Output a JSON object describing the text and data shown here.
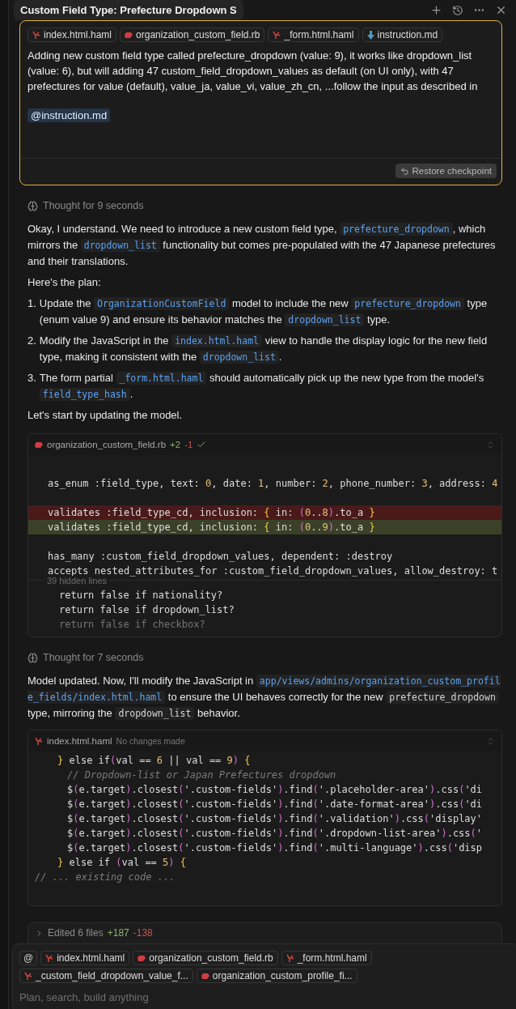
{
  "header": {
    "title": "Custom Field Type: Prefecture Dropdown S"
  },
  "prompt": {
    "attachments": [
      {
        "name": "index.html.haml",
        "kind": "haml"
      },
      {
        "name": "organization_custom_field.rb",
        "kind": "ruby"
      },
      {
        "name": "_form.html.haml",
        "kind": "haml"
      },
      {
        "name": "instruction.md",
        "kind": "markdown"
      }
    ],
    "text": "Adding new custom field type called prefecture_dropdown (value: 9), it works like dropdown_list (value: 6), but will adding 47 custom_field_dropdown_values as default (on UI only), with 47 prefectures for value (default), value_ja, value_vi, value_zh_cn,  ...follow the input as described in",
    "mention": "@instruction.md",
    "restore": "Restore checkpoint"
  },
  "thought_1": "Thought for 9 seconds",
  "message_1": [
    {
      "parts": [
        {
          "kind": "text",
          "text": "Okay, I understand. We need to introduce a new custom field type, "
        },
        {
          "kind": "symbol",
          "text": "prefecture_dropdown"
        },
        {
          "kind": "text",
          "text": ", which mirrors the "
        },
        {
          "kind": "symbol",
          "text": "dropdown_list"
        },
        {
          "kind": "text",
          "text": " functionality but comes pre-populated with the 47 Japanese prefectures and their translations."
        }
      ]
    },
    {
      "parts": [
        {
          "kind": "text",
          "text": "Here's the plan:"
        }
      ]
    }
  ],
  "plan": [
    {
      "number": "1.",
      "parts": [
        {
          "kind": "text",
          "text": "Update the "
        },
        {
          "kind": "symbol",
          "text": "OrganizationCustomField"
        },
        {
          "kind": "text",
          "text": " model to include the new "
        },
        {
          "kind": "symbol",
          "text": "prefecture_dropdown"
        },
        {
          "kind": "text",
          "text": " type (enum value 9) and ensure its behavior matches the "
        },
        {
          "kind": "symbol",
          "text": "dropdown_list"
        },
        {
          "kind": "text",
          "text": " type."
        }
      ]
    },
    {
      "number": "2.",
      "parts": [
        {
          "kind": "text",
          "text": "Modify the JavaScript in the "
        },
        {
          "kind": "symbol",
          "text": "index.html.haml"
        },
        {
          "kind": "text",
          "text": " view to handle the display logic for the new field type, making it consistent with the "
        },
        {
          "kind": "symbol",
          "text": "dropdown_list"
        },
        {
          "kind": "text",
          "text": "."
        }
      ]
    },
    {
      "number": "3.",
      "parts": [
        {
          "kind": "text",
          "text": "The form partial "
        },
        {
          "kind": "symbol",
          "text": "_form.html.haml"
        },
        {
          "kind": "text",
          "text": " should automatically pick up the new type from the model's "
        },
        {
          "kind": "symbol",
          "text": "field_type_hash"
        },
        {
          "kind": "text",
          "text": "."
        }
      ]
    }
  ],
  "message_2": {
    "parts": [
      {
        "kind": "text",
        "text": "Let's start by updating the model."
      }
    ]
  },
  "diff_card": {
    "file": {
      "name": "organization_custom_field.rb",
      "kind": "ruby"
    },
    "added": "+2",
    "removed": "-1",
    "applied": true,
    "lines": [
      {
        "kind": "blank"
      },
      {
        "kind": "context",
        "text": "as_enum :field_type, text: 0, date: 1, number: 2, phone_number: 3, address: 4"
      },
      {
        "kind": "blank"
      },
      {
        "kind": "removed",
        "text": "validates :field_type_cd, inclusion: { in: (0..8).to_a }"
      },
      {
        "kind": "added",
        "text": "validates :field_type_cd, inclusion: { in: (0..9).to_a }"
      },
      {
        "kind": "blank"
      },
      {
        "kind": "context",
        "text": "has_many :custom_field_dropdown_values, dependent: :destroy"
      },
      {
        "kind": "context",
        "text": "accepts_nested_attributes_for :custom_field_dropdown_values, allow_destroy: t"
      }
    ],
    "hidden": "39 hidden lines",
    "tail": [
      {
        "kind": "context",
        "text": "return false if nationality?"
      },
      {
        "kind": "context",
        "text": "return false if dropdown_list?"
      },
      {
        "kind": "faded",
        "text": "return false if checkbox?"
      }
    ]
  },
  "thought_2": "Thought for 7 seconds",
  "message_3": {
    "parts": [
      {
        "kind": "text",
        "text": "Model updated. Now, I'll modify the JavaScript in "
      },
      {
        "kind": "symbol",
        "text": "app/views/admins/organization_custom_profile_fields/index.html.haml"
      },
      {
        "kind": "text",
        "text": " to ensure the UI behaves correctly for the new "
      },
      {
        "kind": "code",
        "text": "prefecture_dropdown"
      },
      {
        "kind": "text",
        "text": " type, mirroring the "
      },
      {
        "kind": "code",
        "text": "dropdown_list"
      },
      {
        "kind": "text",
        "text": " behavior."
      }
    ]
  },
  "code_card": {
    "file": {
      "name": "index.html.haml",
      "kind": "haml"
    },
    "status": "No changes made",
    "lines": [
      {
        "kind": "indent2",
        "text": "} else if(val == 6 || val == 9) {"
      },
      {
        "kind": "indent3",
        "text": "// Dropdown-list or Japan Prefectures dropdown"
      },
      {
        "kind": "indent3",
        "text": "$(e.target).closest('.custom-fields').find('.placeholder-area').css('di"
      },
      {
        "kind": "indent3",
        "text": "$(e.target).closest('.custom-fields').find('.date-format-area').css('di"
      },
      {
        "kind": "indent3",
        "text": "$(e.target).closest('.custom-fields').find('.validation').css('display'"
      },
      {
        "kind": "indent3",
        "text": "$(e.target).closest('.custom-fields').find('.dropdown-list-area').css('"
      },
      {
        "kind": "indent3",
        "text": "$(e.target).closest('.custom-fields').find('.multi-language').css('disp"
      },
      {
        "kind": "indent2",
        "text": "} else if (val == 5) {"
      },
      {
        "kind": "indent0",
        "text": "// ... existing code ..."
      }
    ]
  },
  "edited": {
    "label": "Edited 6 files",
    "added": "+187",
    "removed": "-138",
    "expanded": false
  },
  "composer": {
    "mention": "@",
    "attachments": [
      {
        "name": "index.html.haml",
        "kind": "haml"
      },
      {
        "name": "organization_custom_field.rb",
        "kind": "ruby"
      },
      {
        "name": "_form.html.haml",
        "kind": "haml"
      },
      {
        "name": "_custom_field_dropdown_value_f...",
        "kind": "haml"
      },
      {
        "name": "organization_custom_profile_fi...",
        "kind": "ruby"
      }
    ],
    "placeholder": "Plan, search, build anything"
  }
}
